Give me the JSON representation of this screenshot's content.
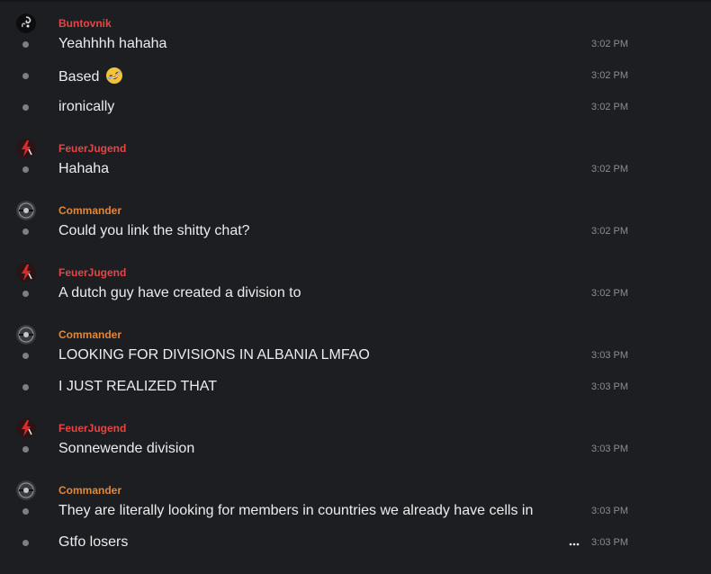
{
  "colors": {
    "background": "#1d1e21",
    "red_author": "#e64545",
    "orange_author": "#e0883a",
    "message_text": "#ececee",
    "timestamp": "#8a8c91"
  },
  "groups": [
    {
      "author": "Buntovnik",
      "author_color": "#e64545",
      "avatar_icon": "dark-spiral-avatar-icon",
      "messages": [
        {
          "text": "Yeahhhh hahaha",
          "time": "3:02 PM"
        },
        {
          "text": "Based",
          "emoji": "rofl-emoji-icon",
          "time": "3:02 PM"
        },
        {
          "text": "ironically",
          "time": "3:02 PM"
        }
      ]
    },
    {
      "author": "FeuerJugend",
      "author_color": "#e64545",
      "avatar_icon": "red-lightning-avatar-icon",
      "messages": [
        {
          "text": "Hahaha",
          "time": "3:02 PM"
        }
      ]
    },
    {
      "author": "Commander",
      "author_color": "#e0883a",
      "avatar_icon": "gray-emblem-avatar-icon",
      "messages": [
        {
          "text": "Could you link the shitty chat?",
          "time": "3:02 PM"
        }
      ]
    },
    {
      "author": "FeuerJugend",
      "author_color": "#e64545",
      "avatar_icon": "red-lightning-avatar-icon",
      "messages": [
        {
          "text": "A dutch guy have created a division to",
          "time": "3:02 PM"
        }
      ]
    },
    {
      "author": "Commander",
      "author_color": "#e0883a",
      "avatar_icon": "gray-emblem-avatar-icon",
      "messages": [
        {
          "text": "LOOKING FOR DIVISIONS IN ALBANIA LMFAO",
          "time": "3:03 PM"
        },
        {
          "text": "I JUST REALIZED THAT",
          "time": "3:03 PM"
        }
      ]
    },
    {
      "author": "FeuerJugend",
      "author_color": "#e64545",
      "avatar_icon": "red-lightning-avatar-icon",
      "messages": [
        {
          "text": "Sonnewende division",
          "time": "3:03 PM"
        }
      ]
    },
    {
      "author": "Commander",
      "author_color": "#e0883a",
      "avatar_icon": "gray-emblem-avatar-icon",
      "messages": [
        {
          "text": "They are literally looking for members in countries we already have cells in",
          "time": "3:03 PM"
        },
        {
          "text": "Gtfo losers",
          "time": "3:03 PM",
          "hover_action": "more-options-icon"
        }
      ]
    }
  ]
}
